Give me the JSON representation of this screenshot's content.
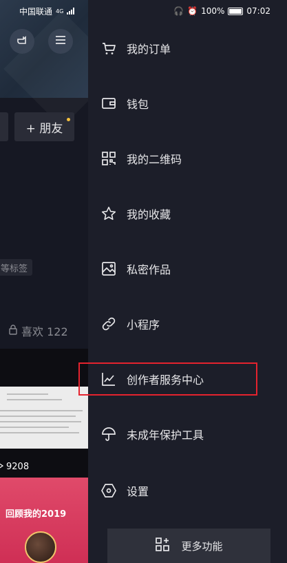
{
  "status_bar": {
    "carrier": "中国联通",
    "network": "4G",
    "battery": "100%",
    "time": "07:02"
  },
  "background_profile": {
    "add_friend_label": "+ 朋友",
    "tag_text": "等标签",
    "likes_label": "喜欢 122",
    "video_views": "9208",
    "banner_text": "回顾我的2019"
  },
  "drawer": {
    "menu_items": [
      {
        "label": "我的订单",
        "icon": "cart-icon"
      },
      {
        "label": "钱包",
        "icon": "wallet-icon"
      },
      {
        "label": "我的二维码",
        "icon": "qrcode-icon"
      },
      {
        "label": "我的收藏",
        "icon": "star-icon"
      },
      {
        "label": "私密作品",
        "icon": "private-image-icon"
      },
      {
        "label": "小程序",
        "icon": "link-icon"
      },
      {
        "label": "创作者服务中心",
        "icon": "chart-line-icon"
      },
      {
        "label": "未成年保护工具",
        "icon": "umbrella-icon"
      },
      {
        "label": "设置",
        "icon": "settings-hexagon-icon"
      }
    ],
    "more_button_label": "更多功能",
    "highlight_color": "#e5232e"
  }
}
